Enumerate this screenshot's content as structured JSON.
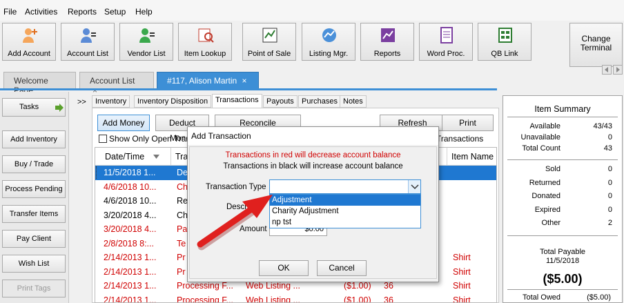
{
  "menu": [
    "File",
    "Activities",
    "Reports",
    "Setup",
    "Help"
  ],
  "toolbar": [
    "Add Account",
    "Account List",
    "Vendor List",
    "Item Lookup",
    "Point of Sale",
    "Listing Mgr.",
    "Reports",
    "Word Proc.",
    "QB Link"
  ],
  "change_terminal": [
    "Change",
    "Terminal"
  ],
  "doc_tabs": [
    "Welcome Page",
    "Account List",
    "#117, Alison Martin"
  ],
  "close_glyph": "×",
  "side": {
    "tasks": "Tasks",
    "buttons": [
      "Add Inventory",
      "Buy / Trade",
      "Process Pending",
      "Transfer Items",
      "Pay Client",
      "Wish List",
      "Print Tags"
    ]
  },
  "expand": ">>",
  "sub_tabs": [
    "Inventory",
    "Inventory Disposition",
    "Transactions",
    "Payouts",
    "Purchases",
    "Notes"
  ],
  "actions": {
    "add_money": "Add Money",
    "deduct_money": "Deduct Money",
    "reconcile": "Reconcile Transactions",
    "refresh": "Refresh",
    "print": "Print"
  },
  "show_open": "Show Only Open Transa",
  "show_right": "Transactions",
  "grid": {
    "headers": [
      "Date/Time",
      "Tra",
      "Item Name"
    ],
    "rows": [
      {
        "date": "11/5/2018 1...",
        "type": "De",
        "src": "",
        "amt": "",
        "qty": "",
        "item": "",
        "style": "sel"
      },
      {
        "date": "4/6/2018 10...",
        "type": "Ch",
        "src": "",
        "amt": "",
        "qty": "",
        "item": "",
        "style": "red"
      },
      {
        "date": "4/6/2018 10...",
        "type": "Re",
        "src": "",
        "amt": "",
        "qty": "",
        "item": "",
        "style": "black"
      },
      {
        "date": "3/20/2018 4...",
        "type": "Ch",
        "src": "",
        "amt": "",
        "qty": "",
        "item": "",
        "style": "black"
      },
      {
        "date": "3/20/2018 4...",
        "type": "Pa",
        "src": "",
        "amt": "",
        "qty": "",
        "item": "",
        "style": "red"
      },
      {
        "date": "2/8/2018 8:...",
        "type": "Te",
        "src": "",
        "amt": "",
        "qty": "",
        "item": "",
        "style": "red"
      },
      {
        "date": "2/14/2013 1...",
        "type": "Pr",
        "src": "",
        "amt": "",
        "qty": "",
        "item": "Shirt",
        "style": "red"
      },
      {
        "date": "2/14/2013 1...",
        "type": "Pr",
        "src": "",
        "amt": "",
        "qty": "",
        "item": "Shirt",
        "style": "red"
      },
      {
        "date": "2/14/2013 1...",
        "type": "Processing F...",
        "src": "Web Listing ...",
        "amt": "($1.00)",
        "qty": "36",
        "item": "Shirt",
        "style": "red"
      },
      {
        "date": "2/14/2013 1...",
        "type": "Processing F...",
        "src": "Web Listing ...",
        "amt": "($1.00)",
        "qty": "36",
        "item": "Shirt",
        "style": "red"
      }
    ]
  },
  "summary": {
    "title": "Item Summary",
    "top": [
      [
        "Available",
        "43/43"
      ],
      [
        "Unavailable",
        "0"
      ],
      [
        "Total Count",
        "43"
      ]
    ],
    "mid": [
      [
        "Sold",
        "0"
      ],
      [
        "Returned",
        "0"
      ],
      [
        "Donated",
        "0"
      ],
      [
        "Expired",
        "0"
      ],
      [
        "Other",
        "2"
      ]
    ],
    "payable_label": "Total Payable",
    "payable_date": "11/5/2018",
    "payable_amount": "($5.00)",
    "owed_label": "Total Owed",
    "owed_value": "($5.00)"
  },
  "dialog": {
    "title": "Add Transaction",
    "red_note": "Transactions in red will decrease account balance",
    "black_note": "Transactions in black will increase account balance",
    "type_label": "Transaction Type",
    "desc_label": "Descriptio",
    "amount_label": "Amount",
    "amount_value": "$0.00",
    "options": [
      "Adjustment",
      "Charity Adjustment",
      "np tst"
    ],
    "ok": "OK",
    "cancel": "Cancel"
  },
  "colors": {
    "accent": "#3d8fd6",
    "selection": "#1f78d1",
    "red": "#d00000",
    "arrow": "#e0201e"
  }
}
